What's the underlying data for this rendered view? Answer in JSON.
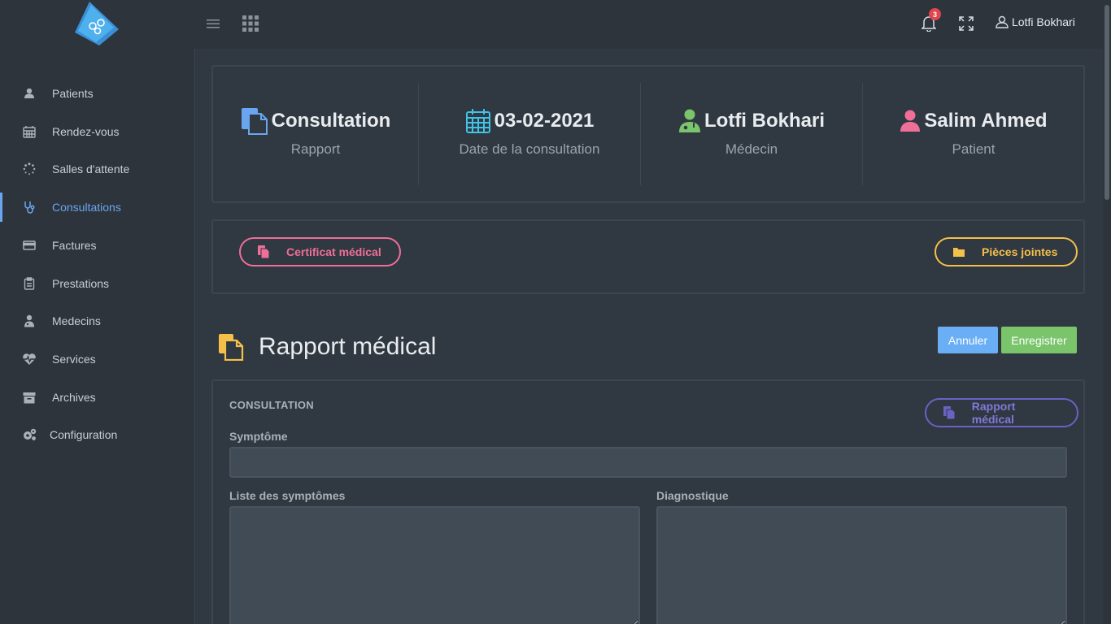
{
  "topbar": {
    "notifications_count": "3",
    "user_name": "Lotfi Bokhari"
  },
  "sidebar": {
    "items": [
      {
        "label": "Patients",
        "icon": "user-icon"
      },
      {
        "label": "Rendez-vous",
        "icon": "calendar-icon"
      },
      {
        "label": "Salles d'attente",
        "icon": "spinner-icon"
      },
      {
        "label": "Consultations",
        "icon": "stethoscope-icon",
        "active": true
      },
      {
        "label": "Factures",
        "icon": "credit-card-icon"
      },
      {
        "label": "Prestations",
        "icon": "clipboard-icon"
      },
      {
        "label": "Medecins",
        "icon": "doctor-icon"
      },
      {
        "label": "Services",
        "icon": "heartbeat-icon"
      },
      {
        "label": "Archives",
        "icon": "archive-icon"
      },
      {
        "label": "Configuration",
        "icon": "cogs-icon"
      }
    ]
  },
  "summary": {
    "report": {
      "value": "Consultation",
      "label": "Rapport"
    },
    "date": {
      "value": "03-02-2021",
      "label": "Date de la consultation"
    },
    "doctor": {
      "value": "Lotfi Bokhari",
      "label": "Médecin"
    },
    "patient": {
      "value": "Salim Ahmed",
      "label": "Patient"
    }
  },
  "actions": {
    "certificate": "Certificat médical",
    "attachments": "Pièces jointes"
  },
  "page": {
    "title": "Rapport médical",
    "cancel": "Annuler",
    "save": "Enregistrer"
  },
  "form": {
    "section": "CONSULTATION",
    "report_button": "Rapport médical",
    "symptom_label": "Symptôme",
    "symptom_value": "",
    "symptom_list_label": "Liste des symptômes",
    "diagnosis_label": "Diagnostique"
  },
  "colors": {
    "accent_blue": "#6aa6f0",
    "pink": "#ee6f98",
    "yellow": "#f5c04a",
    "purple": "#6a62c4",
    "green": "#7ac46b",
    "cyan": "#3fc3e6"
  }
}
